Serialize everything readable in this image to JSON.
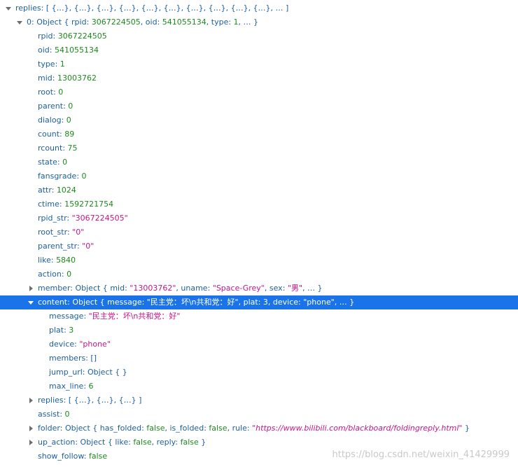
{
  "tree": {
    "replies_summary": "[ {…}, {…}, {…}, {…}, {…}, {…}, {…}, {…}, {…}, {…}, … ]",
    "obj0_rpid_value": "3067224505",
    "obj0_oid_value": "541055134",
    "obj0_type_value": "1",
    "fields": [
      {
        "key": "rpid",
        "value": "3067224505"
      },
      {
        "key": "oid",
        "value": "541055134"
      },
      {
        "key": "type",
        "value": "1"
      },
      {
        "key": "mid",
        "value": "13003762"
      },
      {
        "key": "root",
        "value": "0"
      },
      {
        "key": "parent",
        "value": "0"
      },
      {
        "key": "dialog",
        "value": "0"
      },
      {
        "key": "count",
        "value": "89"
      },
      {
        "key": "rcount",
        "value": "75"
      },
      {
        "key": "state",
        "value": "0"
      },
      {
        "key": "fansgrade",
        "value": "0"
      },
      {
        "key": "attr",
        "value": "1024"
      },
      {
        "key": "ctime",
        "value": "1592721754"
      },
      {
        "key": "rpid_str",
        "value": "\"3067224505\""
      },
      {
        "key": "root_str",
        "value": "\"0\""
      },
      {
        "key": "parent_str",
        "value": "\"0\""
      },
      {
        "key": "like",
        "value": "5840"
      },
      {
        "key": "action",
        "value": "0"
      }
    ],
    "member": {
      "key": "member",
      "mid": "\"13003762\"",
      "uname": "\"Space-Grey\"",
      "sex": "\"男\""
    },
    "content": {
      "key": "content",
      "message": "\"民主党：坏\\n共和党：好\"",
      "plat": "3",
      "device": "\"phone\"",
      "fields": [
        {
          "key": "message",
          "value": "\"民主党：坏\\n共和党：好\""
        },
        {
          "key": "plat",
          "value": "3"
        },
        {
          "key": "device",
          "value": "\"phone\""
        },
        {
          "key": "members",
          "value": "[]"
        },
        {
          "key": "jump_url",
          "value": "Object { }"
        },
        {
          "key": "max_line",
          "value": "6"
        }
      ]
    },
    "replies_nested": {
      "key": "replies",
      "summary": "[ {…}, {…}, {…} ]"
    },
    "assist": {
      "key": "assist",
      "value": "0"
    },
    "folder": {
      "key": "folder",
      "has_folded": "false",
      "is_folded": "false",
      "rule": "https://www.bilibili.com/blackboard/foldingreply.html"
    },
    "up_action": {
      "key": "up_action",
      "like": "false",
      "reply": "false"
    },
    "show_follow": {
      "key": "show_follow",
      "value": "false"
    }
  },
  "watermark": "https://blog.csdn.net/weixin_41429999"
}
